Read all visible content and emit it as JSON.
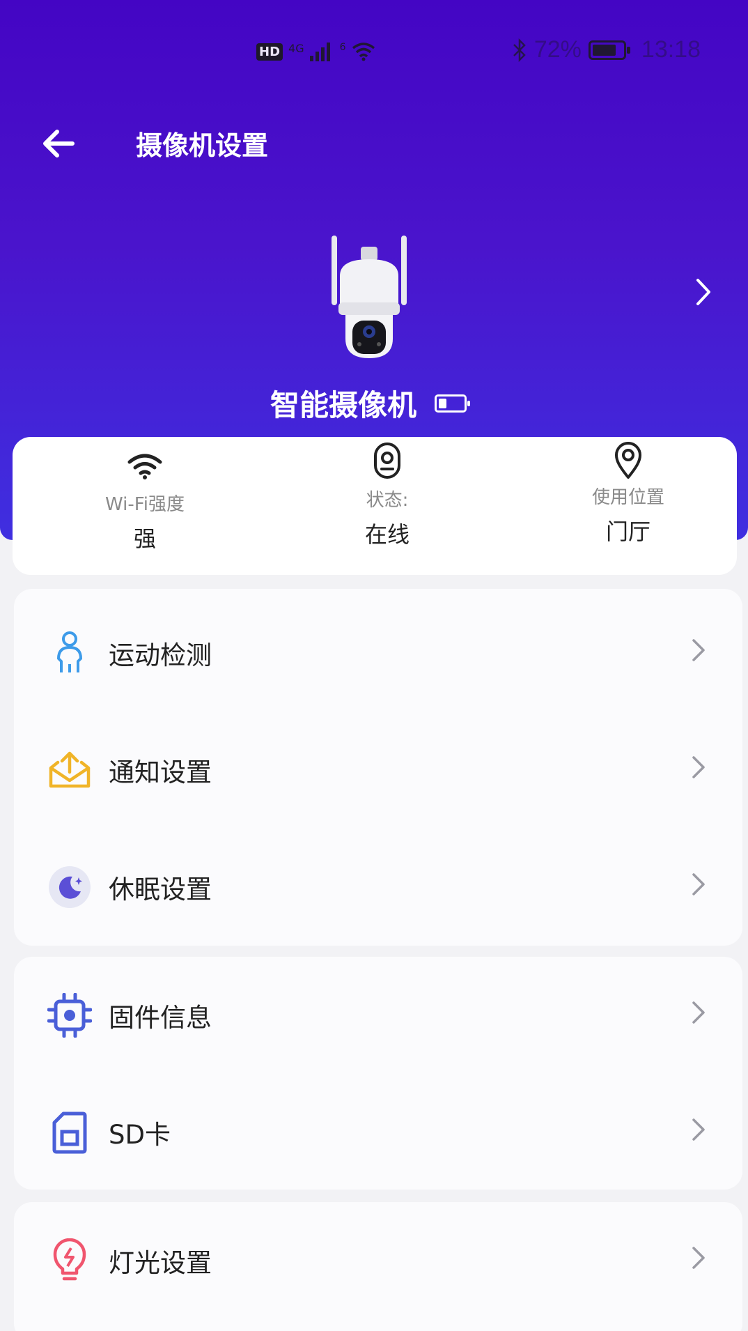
{
  "status_bar": {
    "network": "4G",
    "wifi_badge": "6",
    "hd_label": "HD",
    "battery_percent": "72%",
    "time": "13:18"
  },
  "header": {
    "title": "摄像机设置",
    "device_name": "智能摄像机"
  },
  "info": {
    "wifi": {
      "label": "Wi-Fi强度",
      "value": "强"
    },
    "status": {
      "label": "状态:",
      "value": "在线"
    },
    "location": {
      "label": "使用位置",
      "value": "门厅"
    }
  },
  "menu": {
    "motion": "运动检测",
    "notify": "通知设置",
    "sleep": "休眠设置",
    "firmware": "固件信息",
    "sd": "SD卡",
    "light": "灯光设置"
  },
  "colors": {
    "header_top": "#4405c4",
    "header_bottom": "#3f2fe0",
    "motion_icon": "#3d9be9",
    "notify_icon": "#f0b428",
    "sleep_icon": "#5b4fd6",
    "firmware_icon": "#4a5fd8",
    "sd_icon": "#4a5fd8",
    "light_icon": "#f0556e"
  }
}
